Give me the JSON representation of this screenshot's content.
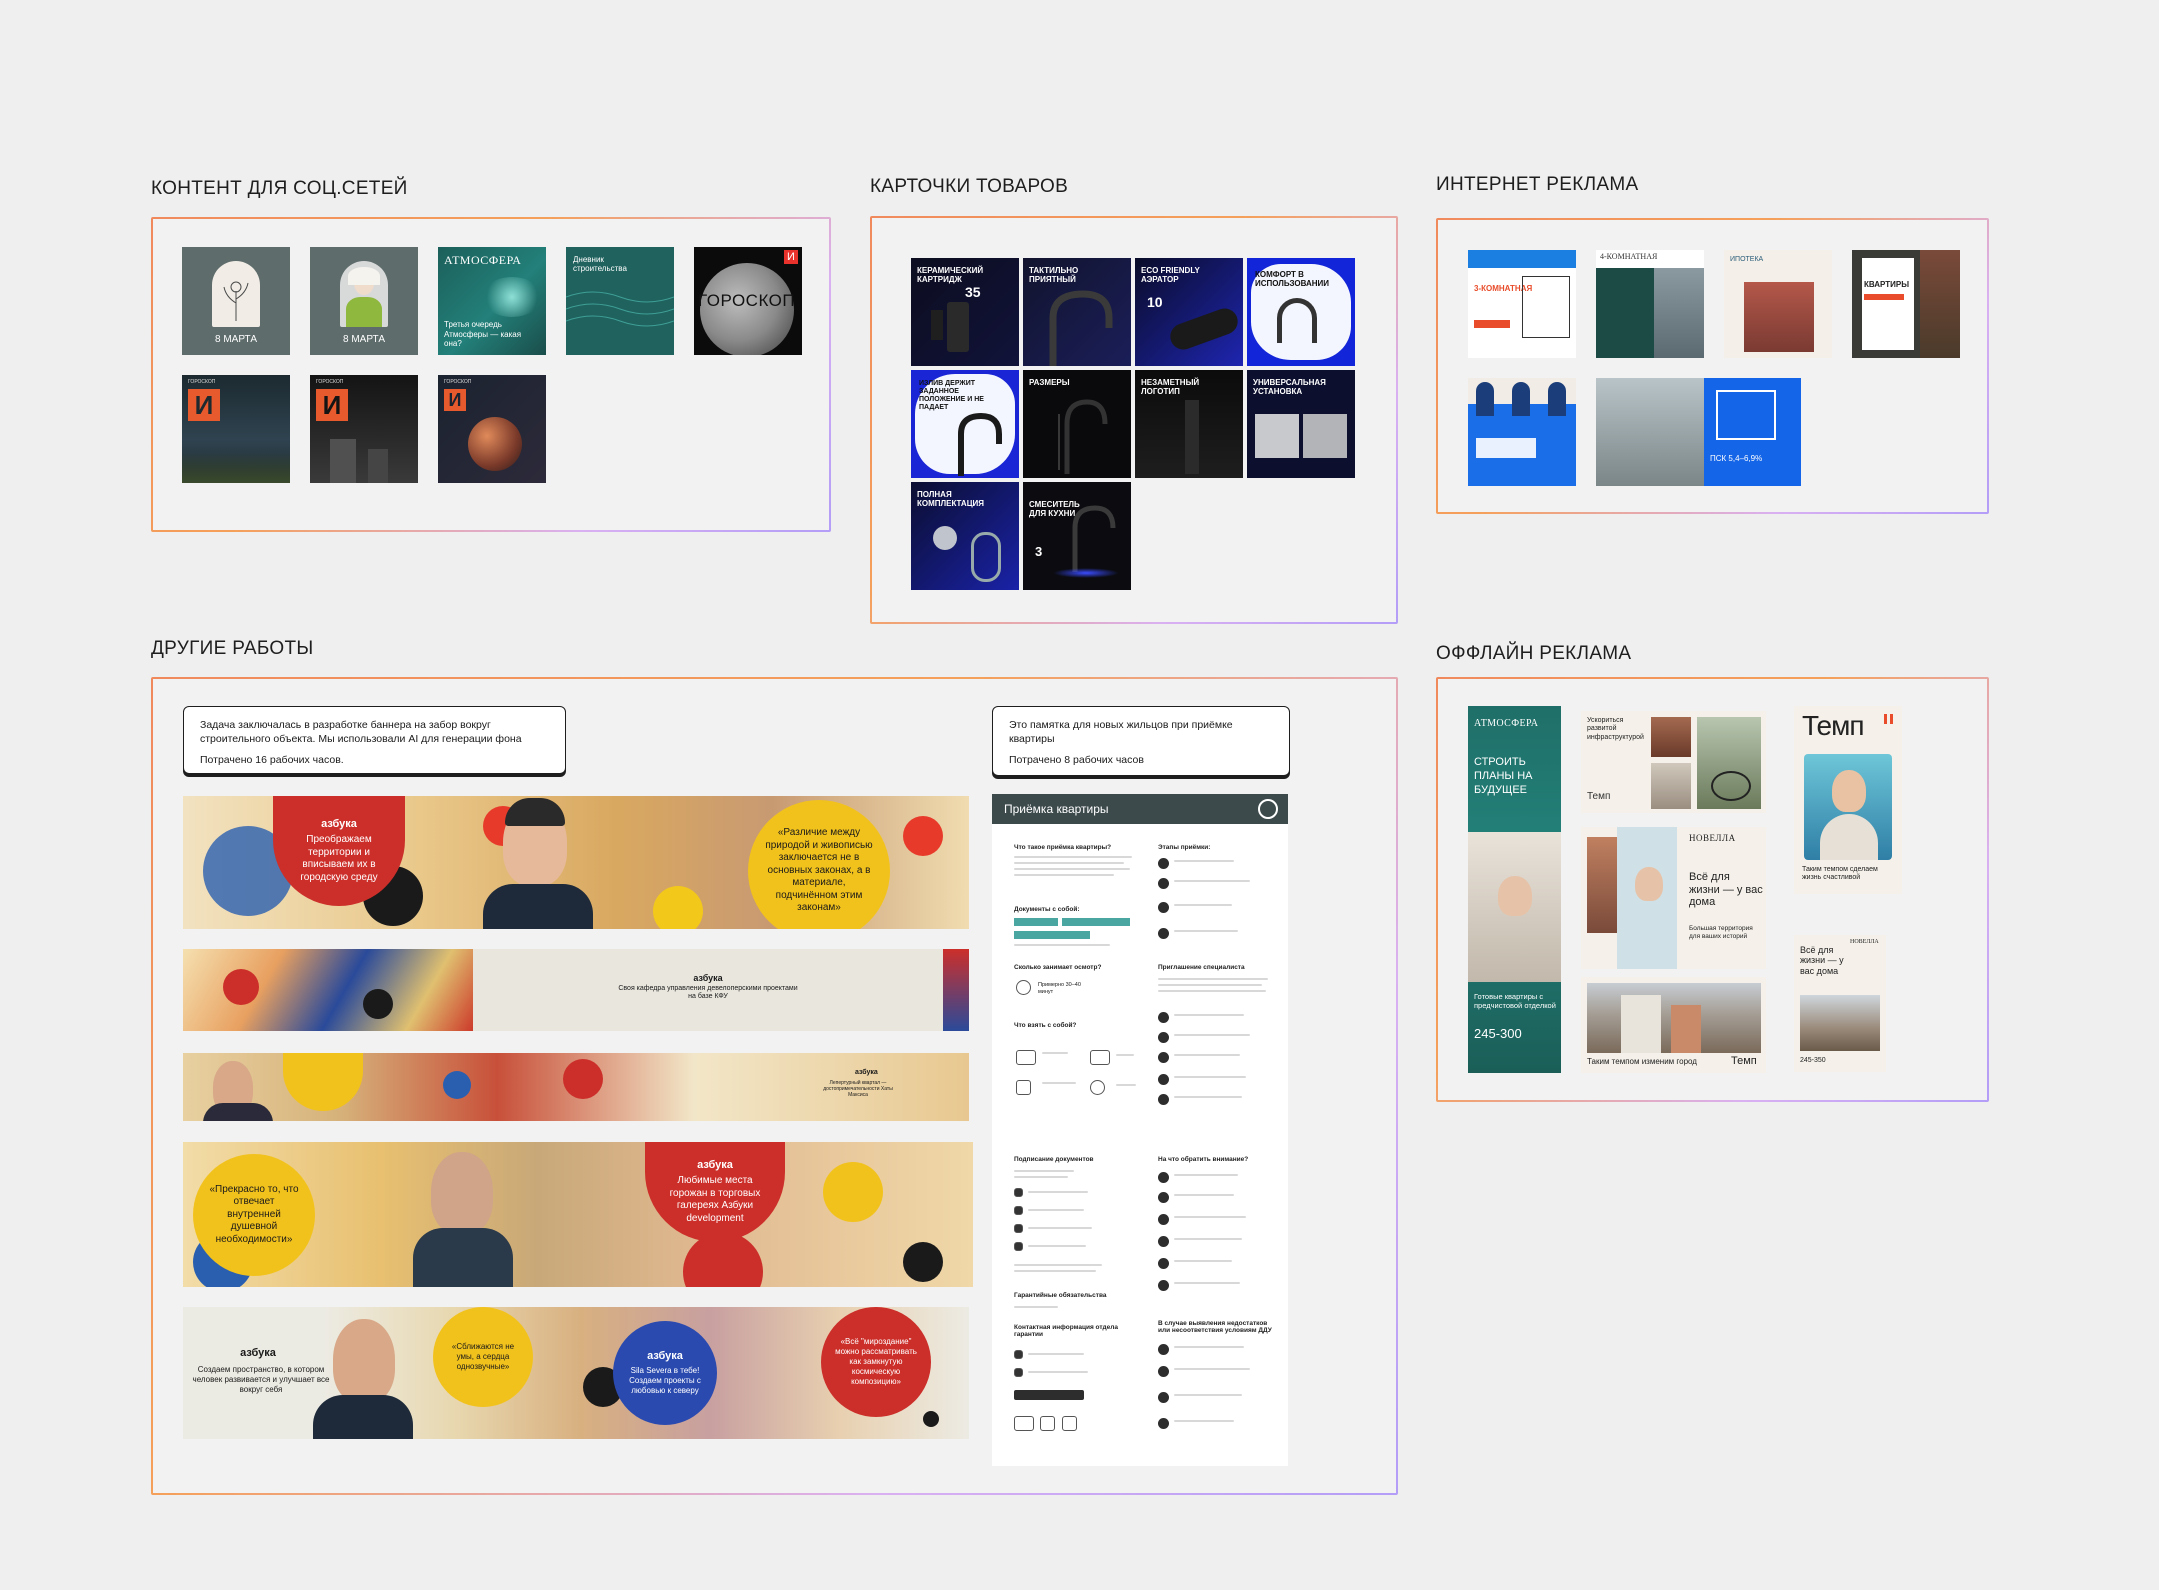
{
  "sections": {
    "social": "КОНТЕНТ ДЛЯ СОЦ.СЕТЕЙ",
    "cards": "КАРТОЧКИ ТОВАРОВ",
    "internet": "ИНТЕРНЕТ РЕКЛАМА",
    "other": "ДРУГИЕ РАБОТЫ",
    "offline": "ОФФЛАЙН РЕКЛАМА"
  },
  "social": {
    "t1_cap": "8 МАРТА",
    "t2_cap": "8 МАРТА",
    "t3_logo": "АТМОСФЕРА",
    "t3_text": "Третья очередь Атмосферы — какая она?",
    "t4_title": "Дневник строительства",
    "t5_text": "ГОРОСКОП",
    "t6_label": "ГОРОСКОП",
    "t7_label": "ГОРОСКОП",
    "t8_label": "ГОРОСКОП",
    "letter": "И"
  },
  "cards": {
    "c1": "КЕРАМИЧЕСКИЙ КАРТРИДЖ",
    "c1_num": "35",
    "c2": "ТАКТИЛЬНО ПРИЯТНЫЙ",
    "c3": "ECO FRIENDLY АЭРАТОР",
    "c3_num": "10",
    "c4": "КОМФОРТ В ИСПОЛЬЗОВАНИИ",
    "c5": "ИЗЛИВ ДЕРЖИТ ЗАДАННОЕ ПОЛОЖЕНИЕ И НЕ ПАДАЕТ",
    "c6": "РАЗМЕРЫ",
    "c7": "НЕЗАМЕТНЫЙ ЛОГОТИП",
    "c8": "УНИВЕРСАЛЬНАЯ УСТАНОВКА",
    "c9": "ПОЛНАЯ КОМПЛЕКТАЦИЯ",
    "c10": "СМЕСИТЕЛЬ ДЛЯ КУХНИ",
    "c10_num": "3"
  },
  "internet": {
    "i1": "3-КОМНАТНАЯ",
    "i2": "4-КОМНАТНАЯ",
    "i3": "ИПОТЕКА",
    "i4": "КВАРТИРЫ",
    "i7": "ПСК 5,4–6,9%"
  },
  "other": {
    "note1_p1": "Задача заключалась в разработке баннера на забор вокруг строительного объекта. Мы использовали AI для генерации фона",
    "note1_p2": "Потрачено 16 рабочих часов.",
    "note2_p1": "Это памятка для новых жильцов при приёмке квартиры",
    "note2_p2": "Потрачено 8 рабочих часов",
    "brand": "азбука",
    "b1_left": "Преображаем территории и вписываем их в городскую среду",
    "b1_right": "«Различие между природой и живописью заключается не в основных законах, а в материале, подчинённом этим законам»",
    "b2_text": "Своя кафедра управления девелоперскими проектами на базе КФУ",
    "b3_text": "Лепертурный квартал — достопримечательности Хаты Максиса",
    "b4_center": "Любимые места горожан в торговых галереях Азбуки development",
    "b4_left": "«Прекрасно то, что отвечает внутренней душевной необходимости»",
    "b5_left": "Создаем пространство, в котором человек развивается и улучшает все вокруг себя",
    "b5_yellow": "«Сближаются не умы, а сердца однозвучные»",
    "b5_blue": "Sila Severa в тебе! Создаем проекты с любовью к северу",
    "b5_red": "«Всё \"мироздание\" можно рассматривать как замкнутую космическую композицию»",
    "memo_title": "Приёмка квартиры",
    "memo_h1": "Что такое приёмка квартиры?",
    "memo_h2": "Этапы приёмки:",
    "memo_h3": "Документы с собой:",
    "memo_h4": "Сколько занимает осмотр?",
    "memo_h5": "Приглашение специалиста",
    "memo_h6": "Что взять с собой?",
    "memo_h7": "Подписание документов",
    "memo_h8": "На что обратить внимание?",
    "memo_h9": "Гарантийные обязательства",
    "memo_h10": "Контактная информация отдела гарантии",
    "memo_h11": "В случае выявления недостатков или несоответствия условиям ДДУ",
    "memo_time": "Примерно 30–40 минут"
  },
  "offline": {
    "o1_logo": "АТМОСФЕРА",
    "o1_title": "СТРОИТЬ ПЛАНЫ НА БУДУЩЕЕ",
    "o1_sub": "Готовые квартиры с предчистовой отделкой",
    "o1_phone": "245-300",
    "o2_title": "Ускориться развитой инфраструктурой",
    "o2_logo": "Темп",
    "o3_logo": "Темп",
    "o3_caption": "Таким темпом сделаем жизнь счастливой",
    "o4_logo": "НОВЕЛЛА",
    "o4_title": "Всё для жизни — у вас дома",
    "o4_sub": "Большая территория для ваших историй",
    "o5_caption": "Таким темпом изменим город",
    "o5_logo": "Темп",
    "o6_logo": "НОВЕЛЛА",
    "o6_title": "Всё для жизни — у вас дома",
    "o6_phone": "245-350"
  }
}
